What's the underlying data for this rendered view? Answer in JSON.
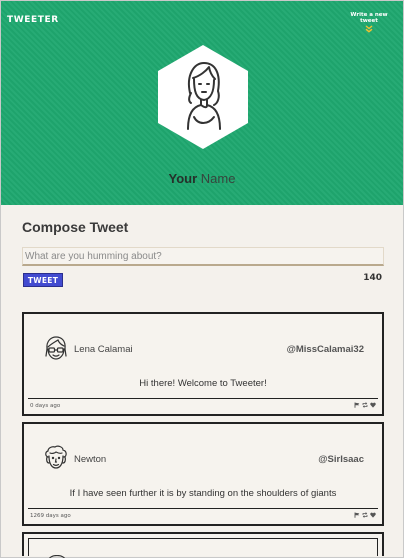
{
  "header": {
    "logo": "TWEETER",
    "write_link": "Write a new tweet",
    "write_icon": "double-chevron-down-icon",
    "accent_color": "#1fa870",
    "profile": {
      "name_bold": "Your",
      "name_light": "Name",
      "avatar_icon": "woman-avatar-icon"
    }
  },
  "compose": {
    "title": "Compose Tweet",
    "placeholder": "What are you humming about?",
    "value": "",
    "button_label": "TWEET",
    "button_color": "#424bd0",
    "char_count": "140"
  },
  "tweets": [
    {
      "name": "Lena Calamai",
      "handle": "@MissCalamai32",
      "text": "Hi there! Welcome to Tweeter!",
      "time": "0 days ago",
      "avatar_icon": "glasses-avatar-icon",
      "actions": [
        "flag-icon",
        "retweet-icon",
        "heart-icon"
      ]
    },
    {
      "name": "Newton",
      "handle": "@SirIsaac",
      "text": "If I have seen further it is by standing on the shoulders of giants",
      "time": "1269 days ago",
      "avatar_icon": "curly-hair-avatar-icon",
      "actions": [
        "flag-icon",
        "retweet-icon",
        "heart-icon"
      ]
    }
  ]
}
